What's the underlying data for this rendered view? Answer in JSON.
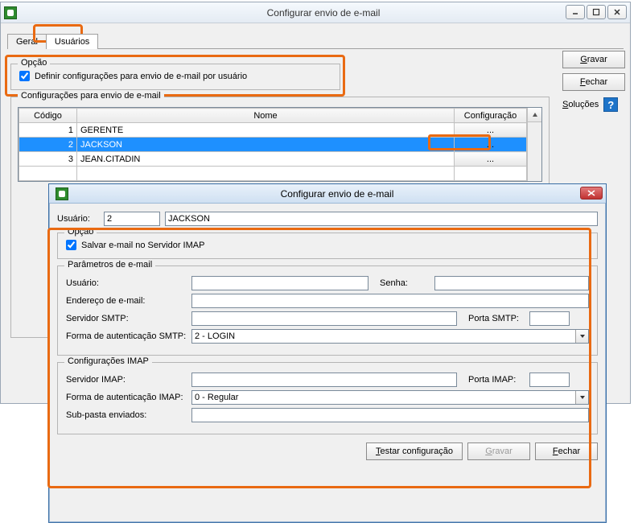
{
  "main": {
    "title": "Configurar envio de e-mail",
    "tabs": {
      "geral": "Geral",
      "usuarios": "Usuários"
    },
    "buttons": {
      "gravar": "Gravar",
      "fechar": "Fechar",
      "solucoes": "Soluções"
    },
    "opcao": {
      "legend": "Opção",
      "check_label": "Definir configurações para envio de e-mail por usuário"
    },
    "config": {
      "legend": "Configurações para envio de e-mail",
      "columns": {
        "codigo": "Código",
        "nome": "Nome",
        "config": "Configuração"
      },
      "rows": [
        {
          "codigo": "1",
          "nome": "GERENTE",
          "btn": "..."
        },
        {
          "codigo": "2",
          "nome": "JACKSON",
          "btn": "..."
        },
        {
          "codigo": "3",
          "nome": "JEAN.CITADIN",
          "btn": "..."
        }
      ]
    }
  },
  "dialog": {
    "title": "Configurar envio de e-mail",
    "usuario_label": "Usuário:",
    "usuario_code": "2",
    "usuario_name": "JACKSON",
    "opcao": {
      "legend": "Opção",
      "check_label": "Salvar e-mail no Servidor IMAP"
    },
    "param": {
      "legend": "Parâmetros de e-mail",
      "usuario": "Usuário:",
      "senha": "Senha:",
      "endereco": "Endereço de e-mail:",
      "smtp": "Servidor SMTP:",
      "porta_smtp": "Porta SMTP:",
      "auth_smtp": "Forma de autenticação SMTP:",
      "auth_smtp_val": "2 - LOGIN"
    },
    "imap": {
      "legend": "Configurações IMAP",
      "servidor": "Servidor IMAP:",
      "porta": "Porta IMAP:",
      "auth": "Forma de autenticação IMAP:",
      "auth_val": "0 - Regular",
      "subpasta": "Sub-pasta enviados:"
    },
    "buttons": {
      "testar": "Testar configuração",
      "gravar": "Gravar",
      "fechar": "Fechar"
    }
  },
  "icons": {
    "help": "?"
  }
}
